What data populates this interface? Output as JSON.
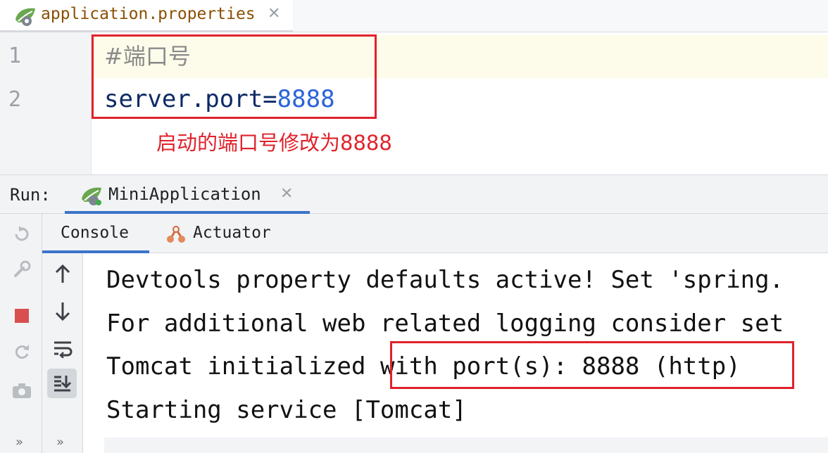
{
  "editor_tab": {
    "filename": "application.properties",
    "close": "✕",
    "icon": "spring-config-icon"
  },
  "editor": {
    "line_numbers": [
      "1",
      "2"
    ],
    "line1_comment": "#端口号",
    "line2_key": "server.port",
    "line2_eq": "=",
    "line2_value": "8888",
    "annotation": "启动的端口号修改为8888"
  },
  "run_panel": {
    "label": "Run:",
    "tab_name": "MiniApplication",
    "tab_close": "✕",
    "subtabs": {
      "console": "Console",
      "actuator": "Actuator"
    },
    "more_left": "»",
    "more_right": "»"
  },
  "console": {
    "lines": [
      "Devtools property defaults active! Set 'spring.",
      "For additional web related logging consider set",
      "Tomcat initialized ",
      "Starting service [Tomcat]"
    ],
    "highlight": "with port(s): 8888 (http)"
  },
  "colors": {
    "highlight_border": "#e0222b",
    "accent": "#3b74c9"
  }
}
